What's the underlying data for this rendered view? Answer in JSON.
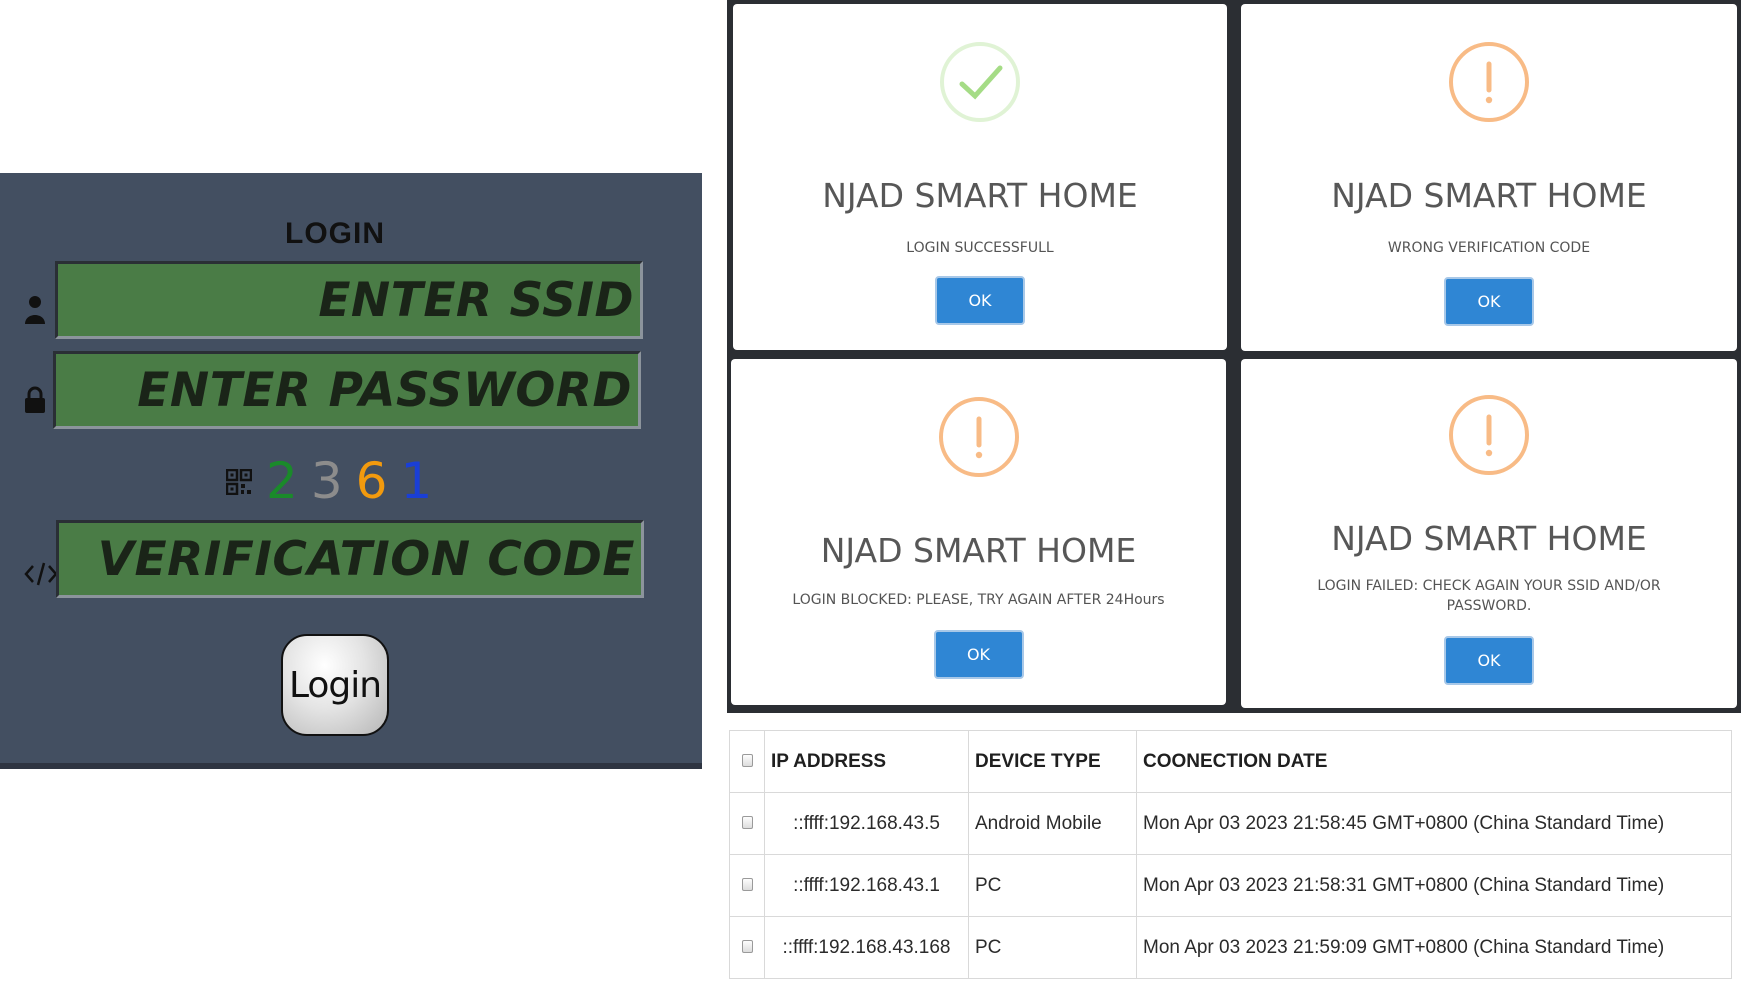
{
  "login": {
    "title": "LOGIN",
    "ssid_placeholder": "ENTER SSID",
    "password_placeholder": "ENTER PASSWORD",
    "verification_placeholder": "VERIFICATION CODE",
    "captcha": [
      {
        "digit": "2",
        "color": "#1a8a2a"
      },
      {
        "digit": "3",
        "color": "#8c8c8c"
      },
      {
        "digit": "6",
        "color": "#f29a0e"
      },
      {
        "digit": "1",
        "color": "#1a3fd6"
      }
    ],
    "button_label": "Login",
    "colors": {
      "panel": "#434f61",
      "field": "#4a7c46"
    }
  },
  "dialogs": [
    {
      "icon": "success-check-icon",
      "title": "NJAD SMART HOME",
      "message": "LOGIN SUCCESSFULL",
      "ok": "OK"
    },
    {
      "icon": "warning-exclamation-icon",
      "title": "NJAD SMART HOME",
      "message": "WRONG VERIFICATION CODE",
      "ok": "OK"
    },
    {
      "icon": "warning-exclamation-icon",
      "title": "NJAD SMART HOME",
      "message": "LOGIN BLOCKED: PLEASE, TRY AGAIN AFTER 24Hours",
      "ok": "OK"
    },
    {
      "icon": "warning-exclamation-icon",
      "title": "NJAD SMART HOME",
      "message": "LOGIN FAILED: CHECK AGAIN YOUR SSID AND/OR PASSWORD.",
      "ok": "OK"
    }
  ],
  "connections": {
    "headers": [
      "IP ADDRESS",
      "DEVICE TYPE",
      "COONECTION DATE"
    ],
    "rows": [
      {
        "ip": "::ffff:192.168.43.5",
        "device": "Android Mobile",
        "date": "Mon Apr 03 2023 21:58:45 GMT+0800 (China Standard Time)"
      },
      {
        "ip": "::ffff:192.168.43.1",
        "device": "PC",
        "date": "Mon Apr 03 2023 21:58:31 GMT+0800 (China Standard Time)"
      },
      {
        "ip": "::ffff:192.168.43.168",
        "device": "PC",
        "date": "Mon Apr 03 2023 21:59:09 GMT+0800 (China Standard Time)"
      }
    ]
  }
}
